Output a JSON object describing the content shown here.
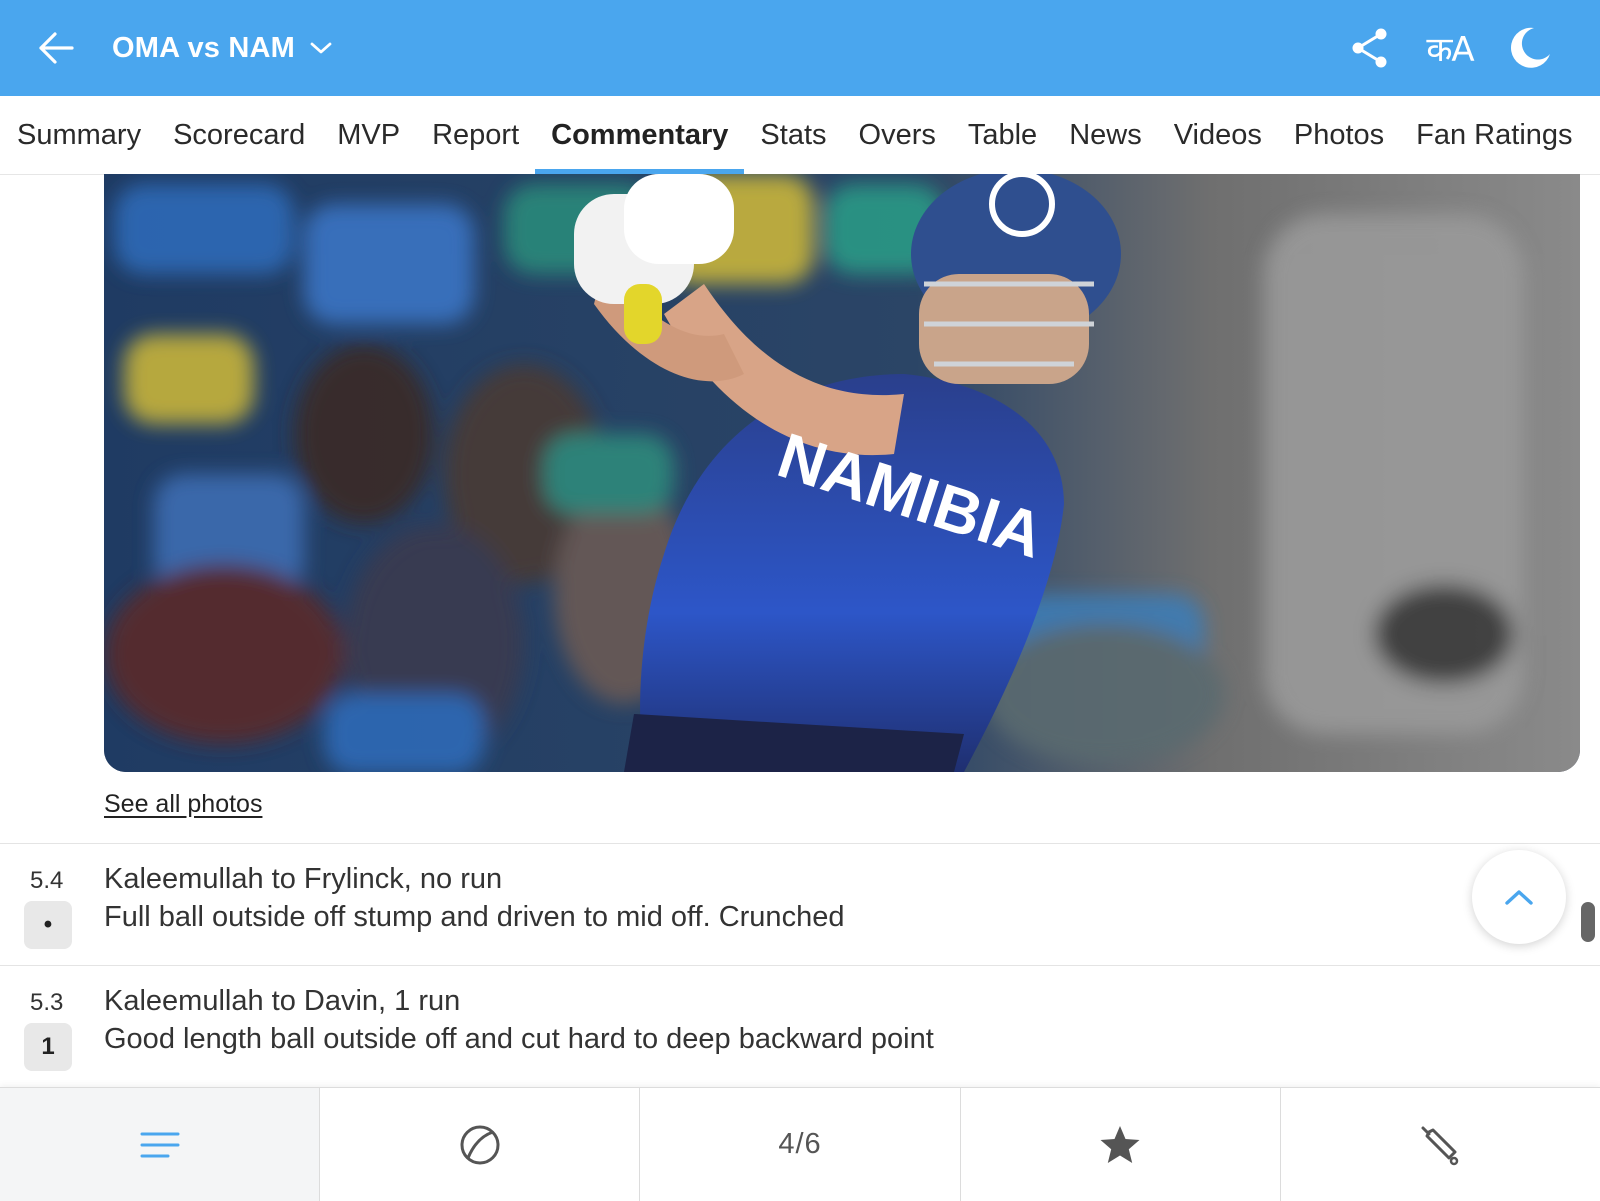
{
  "header": {
    "title": "OMA vs NAM",
    "lang_label": "कA",
    "icons": {
      "back": "arrow-left-icon",
      "title": "chevron-down-icon",
      "share": "share-icon",
      "lang": "language-icon",
      "theme": "moon-icon"
    }
  },
  "tabs": [
    {
      "label": "Summary",
      "active": false
    },
    {
      "label": "Scorecard",
      "active": false
    },
    {
      "label": "MVP",
      "active": false
    },
    {
      "label": "Report",
      "active": false
    },
    {
      "label": "Commentary",
      "active": true
    },
    {
      "label": "Stats",
      "active": false
    },
    {
      "label": "Overs",
      "active": false
    },
    {
      "label": "Table",
      "active": false
    },
    {
      "label": "News",
      "active": false
    },
    {
      "label": "Videos",
      "active": false
    },
    {
      "label": "Photos",
      "active": false
    },
    {
      "label": "Fan Ratings",
      "active": false
    }
  ],
  "photo": {
    "jersey_text": "NAMIBIA",
    "see_all_label": "See all photos"
  },
  "commentary": [
    {
      "over": "5.4",
      "result": "•",
      "headline": "Kaleemullah to Frylinck, no run",
      "text": "Full ball outside off stump and driven to mid off. Crunched"
    },
    {
      "over": "5.3",
      "result": "1",
      "headline": "Kaleemullah to Davin, 1 run",
      "text": "Good length ball outside off and cut hard to deep backward point"
    }
  ],
  "bottom_bar": {
    "page_indicator": "4/6",
    "icons": [
      "menu-icon",
      "ball-icon",
      "page-indicator",
      "star-icon",
      "bat-icon"
    ]
  },
  "colors": {
    "accent": "#4aa6ee",
    "badge_bg": "#e8e8e8"
  }
}
